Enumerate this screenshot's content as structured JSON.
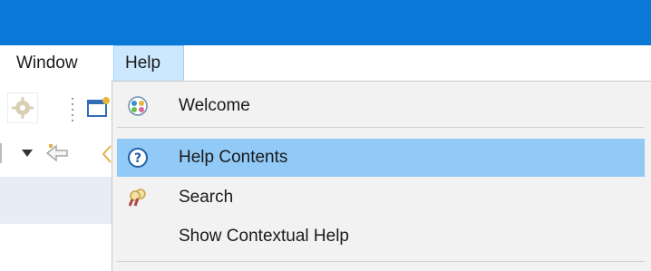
{
  "menubar": {
    "items": [
      {
        "label": "Window"
      },
      {
        "label": "Help"
      }
    ]
  },
  "help_menu": {
    "items": [
      {
        "label": "Welcome",
        "icon": "welcome-icon"
      },
      {
        "label": "Help Contents",
        "icon": "help-contents-icon",
        "highlighted": true
      },
      {
        "label": "Search",
        "icon": "search-icon"
      },
      {
        "label": "Show Contextual Help",
        "icon": ""
      }
    ]
  },
  "colors": {
    "titlebar": "#0a78d7",
    "menu_open_bg": "#cce8ff",
    "highlight_bg": "#91c9f7",
    "menu_bg": "#f2f2f2"
  }
}
